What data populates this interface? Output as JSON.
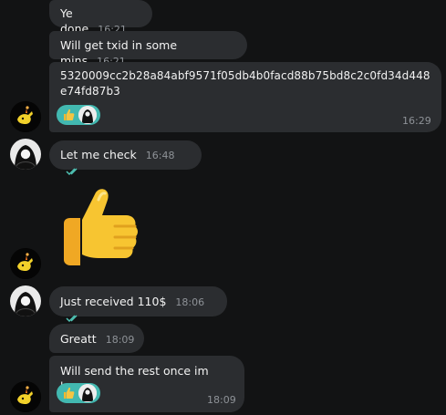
{
  "messages": [
    {
      "text": "Ye done",
      "time": "16:21"
    },
    {
      "text": "Will get txid in some mins",
      "time": "16:21"
    },
    {
      "text": "5320009cc2b28a84abf9571f05db4b0facd88b75bd8c2c0fd34d448e74fd87b3",
      "time": "16:29"
    },
    {
      "text": "Let me check",
      "time": "16:48"
    },
    {
      "text": "Just received 110$",
      "time": "18:06"
    },
    {
      "text": "Greatt",
      "time": "18:09"
    },
    {
      "text": "Will send the rest once im home",
      "time": "18:09"
    }
  ],
  "icons": {
    "reaction": "thumbs-up-icon",
    "read_receipt": "double-check-icon",
    "sticker": "thumbs-up-sticker"
  },
  "colors": {
    "bubble": "#2b2d30",
    "reaction": "#42b8b0",
    "checks": "#4fc3b5"
  }
}
